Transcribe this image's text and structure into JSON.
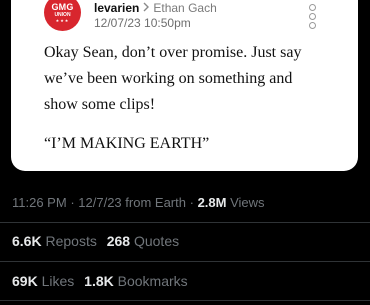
{
  "tweet": {
    "avatar": {
      "line1": "GMG",
      "line2": "UNION",
      "line3": "★★★"
    },
    "username": "levarien",
    "chevron_icon": "chevron-right-icon",
    "display_name": "Ethan Gach",
    "timestamp": "12/07/23 10:50pm",
    "lines": [
      "Okay Sean, don’t over promise. Just say",
      "we’ve been working on something and",
      "show some clips!"
    ],
    "quote": "“I’M MAKING EARTH”"
  },
  "meta": {
    "time": "11:26 PM",
    "sep1": "·",
    "date": "12/7/23",
    "source": "from Earth",
    "sep2": "·",
    "views_count": "2.8M",
    "views_label": "Views"
  },
  "stats": {
    "reposts_count": "6.6K",
    "reposts_label": "Reposts",
    "quotes_count": "268",
    "quotes_label": "Quotes",
    "likes_count": "69K",
    "likes_label": "Likes",
    "bookmarks_count": "1.8K",
    "bookmarks_label": "Bookmarks"
  }
}
